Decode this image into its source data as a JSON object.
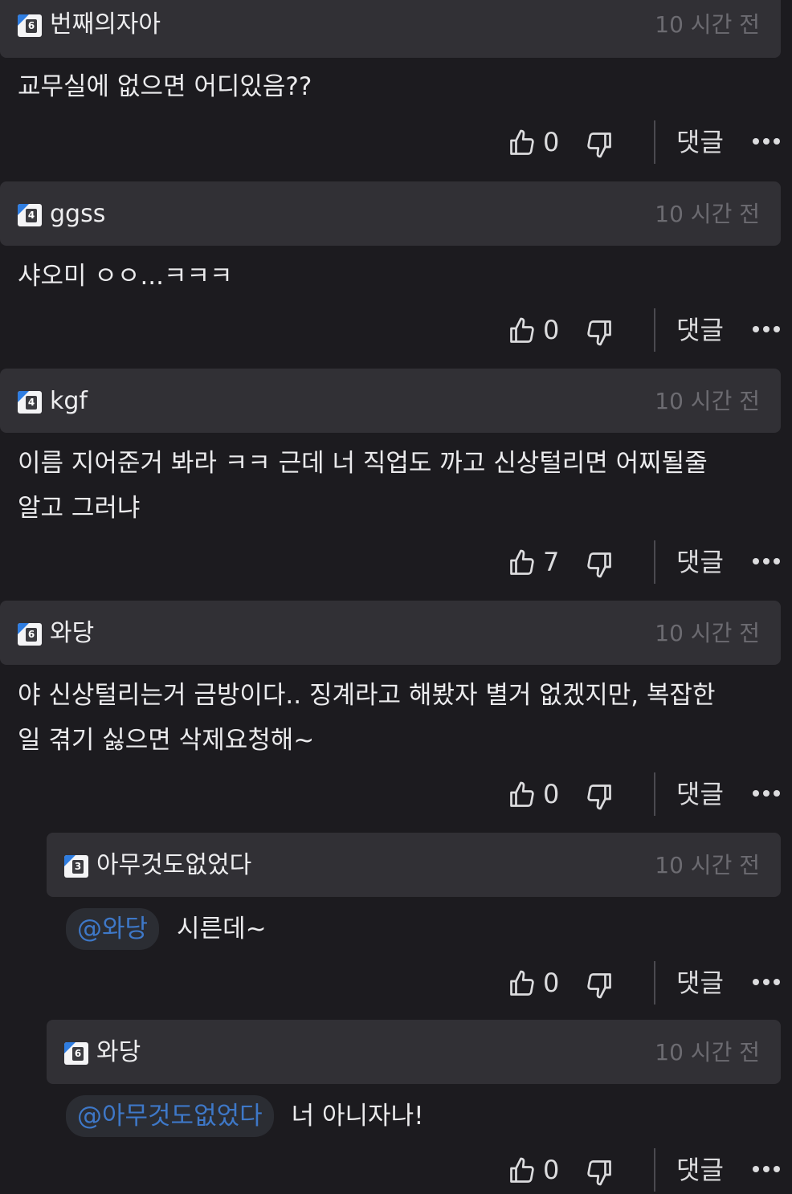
{
  "comments": [
    {
      "level": "6",
      "username": "번째의자아",
      "timestamp": "10 시간 전",
      "mention": "",
      "body": [
        "교무실에 없으면 어디있음??"
      ],
      "likes": "0",
      "reply_label": "댓글",
      "more_icon": "more-horizontal-icon",
      "like_icon": "thumbs-up-icon",
      "dislike_icon": "thumbs-down-icon"
    },
    {
      "level": "4",
      "username": "ggss",
      "timestamp": "10 시간 전",
      "mention": "",
      "body": [
        "샤오미 ㅇㅇ...ㅋㅋㅋ"
      ],
      "likes": "0",
      "reply_label": "댓글"
    },
    {
      "level": "4",
      "username": "kgf",
      "timestamp": "10 시간 전",
      "mention": "",
      "body": [
        "이름 지어준거 봐라 ㅋㅋ 근데 너 직업도 까고 신상털리면 어찌될줄",
        "알고 그러냐"
      ],
      "likes": "7",
      "reply_label": "댓글"
    },
    {
      "level": "6",
      "username": "와당",
      "timestamp": "10 시간 전",
      "mention": "",
      "body": [
        "야 신상털리는거 금방이다.. 징계라고 해봤자 별거 없겠지만, 복잡한",
        "일 겪기 싫으면 삭제요청해~"
      ],
      "likes": "0",
      "reply_label": "댓글"
    },
    {
      "level": "3",
      "username": "아무것도없었다",
      "timestamp": "10 시간 전",
      "mention": "@와당",
      "body": [
        "시른데~"
      ],
      "likes": "0",
      "reply_label": "댓글"
    },
    {
      "level": "6",
      "username": "와당",
      "timestamp": "10 시간 전",
      "mention": "@아무것도없었다",
      "body": [
        "너 아니자나!"
      ],
      "likes": "0",
      "reply_label": "댓글"
    }
  ],
  "colors": {
    "background": "#1c1b1f",
    "header": "#313035",
    "mention_text": "#3e78c8",
    "badge_accent": "#2f7de1",
    "timestamp": "#6c6b71"
  }
}
